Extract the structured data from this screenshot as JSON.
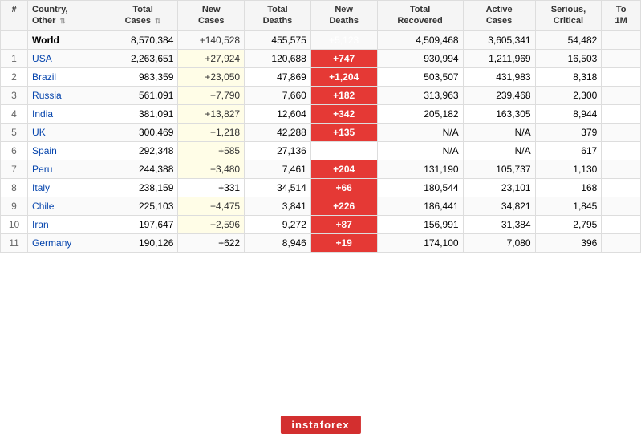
{
  "table": {
    "headers": [
      {
        "label": "#",
        "sub": "",
        "sort": false
      },
      {
        "label": "Country,",
        "sub": "Other",
        "sort": true
      },
      {
        "label": "Total",
        "sub": "Cases",
        "sort": true
      },
      {
        "label": "New",
        "sub": "Cases",
        "sort": false
      },
      {
        "label": "Total",
        "sub": "Deaths",
        "sort": false
      },
      {
        "label": "New",
        "sub": "Deaths",
        "sort": false
      },
      {
        "label": "Total",
        "sub": "Recovered",
        "sort": false
      },
      {
        "label": "Active",
        "sub": "Cases",
        "sort": false
      },
      {
        "label": "Serious,",
        "sub": "Critical",
        "sort": false
      },
      {
        "label": "To",
        "sub": "1M",
        "sort": false
      }
    ],
    "world_row": {
      "rank": "",
      "country": "World",
      "total_cases": "8,570,384",
      "new_cases": "+140,528",
      "total_deaths": "455,575",
      "new_deaths": "+5,123",
      "total_recovered": "4,509,468",
      "active_cases": "3,605,341",
      "serious": "54,482",
      "tot1m": ""
    },
    "rows": [
      {
        "rank": "1",
        "country": "USA",
        "total_cases": "2,263,651",
        "new_cases": "+27,924",
        "total_deaths": "120,688",
        "new_deaths": "+747",
        "total_recovered": "930,994",
        "active_cases": "1,211,969",
        "serious": "16,503",
        "tot1m": "",
        "new_deaths_highlight": true,
        "new_cases_highlight": true
      },
      {
        "rank": "2",
        "country": "Brazil",
        "total_cases": "983,359",
        "new_cases": "+23,050",
        "total_deaths": "47,869",
        "new_deaths": "+1,204",
        "total_recovered": "503,507",
        "active_cases": "431,983",
        "serious": "8,318",
        "tot1m": "",
        "new_deaths_highlight": true,
        "new_cases_highlight": true
      },
      {
        "rank": "3",
        "country": "Russia",
        "total_cases": "561,091",
        "new_cases": "+7,790",
        "total_deaths": "7,660",
        "new_deaths": "+182",
        "total_recovered": "313,963",
        "active_cases": "239,468",
        "serious": "2,300",
        "tot1m": "",
        "new_deaths_highlight": true,
        "new_cases_highlight": true
      },
      {
        "rank": "4",
        "country": "India",
        "total_cases": "381,091",
        "new_cases": "+13,827",
        "total_deaths": "12,604",
        "new_deaths": "+342",
        "total_recovered": "205,182",
        "active_cases": "163,305",
        "serious": "8,944",
        "tot1m": "",
        "new_deaths_highlight": true,
        "new_cases_highlight": true
      },
      {
        "rank": "5",
        "country": "UK",
        "total_cases": "300,469",
        "new_cases": "+1,218",
        "total_deaths": "42,288",
        "new_deaths": "+135",
        "total_recovered": "N/A",
        "active_cases": "N/A",
        "serious": "379",
        "tot1m": "",
        "new_deaths_highlight": true,
        "new_cases_highlight": true
      },
      {
        "rank": "6",
        "country": "Spain",
        "total_cases": "292,348",
        "new_cases": "+585",
        "total_deaths": "27,136",
        "new_deaths": "",
        "total_recovered": "N/A",
        "active_cases": "N/A",
        "serious": "617",
        "tot1m": "",
        "new_deaths_highlight": false,
        "new_cases_highlight": true
      },
      {
        "rank": "7",
        "country": "Peru",
        "total_cases": "244,388",
        "new_cases": "+3,480",
        "total_deaths": "7,461",
        "new_deaths": "+204",
        "total_recovered": "131,190",
        "active_cases": "105,737",
        "serious": "1,130",
        "tot1m": "",
        "new_deaths_highlight": true,
        "new_cases_highlight": true
      },
      {
        "rank": "8",
        "country": "Italy",
        "total_cases": "238,159",
        "new_cases": "+331",
        "total_deaths": "34,514",
        "new_deaths": "+66",
        "total_recovered": "180,544",
        "active_cases": "23,101",
        "serious": "168",
        "tot1m": "",
        "new_deaths_highlight": true,
        "new_cases_highlight": false
      },
      {
        "rank": "9",
        "country": "Chile",
        "total_cases": "225,103",
        "new_cases": "+4,475",
        "total_deaths": "3,841",
        "new_deaths": "+226",
        "total_recovered": "186,441",
        "active_cases": "34,821",
        "serious": "1,845",
        "tot1m": "",
        "new_deaths_highlight": true,
        "new_cases_highlight": true
      },
      {
        "rank": "10",
        "country": "Iran",
        "total_cases": "197,647",
        "new_cases": "+2,596",
        "total_deaths": "9,272",
        "new_deaths": "+87",
        "total_recovered": "156,991",
        "active_cases": "31,384",
        "serious": "2,795",
        "tot1m": "",
        "new_deaths_highlight": true,
        "new_cases_highlight": true
      },
      {
        "rank": "11",
        "country": "Germany",
        "total_cases": "190,126",
        "new_cases": "+622",
        "total_deaths": "8,946",
        "new_deaths": "+19",
        "total_recovered": "174,100",
        "active_cases": "7,080",
        "serious": "396",
        "tot1m": "",
        "new_deaths_highlight": true,
        "new_cases_highlight": false
      }
    ]
  },
  "watermark": "instaforex"
}
